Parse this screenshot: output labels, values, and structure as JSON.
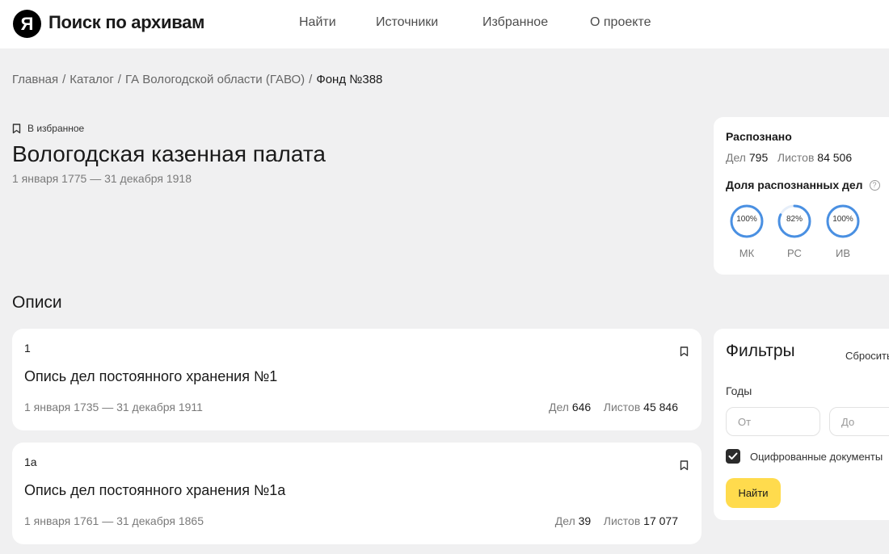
{
  "header": {
    "logo_letter": "Я",
    "logo_text": "Поиск по архивам",
    "nav": [
      "Найти",
      "Источники",
      "Избранное",
      "О проекте"
    ]
  },
  "breadcrumb": [
    "Главная",
    "Каталог",
    "ГА Вологодской области (ГАВО)",
    "Фонд №388"
  ],
  "fund": {
    "favorite_label": "В избранное",
    "title": "Вологодская казенная палата",
    "dates": "1 января 1775 — 31 декабря 1918"
  },
  "recognized": {
    "title": "Распознано",
    "cases_label": "Дел",
    "cases_value": "795",
    "sheets_label": "Листов",
    "sheets_value": "84 506",
    "share_title": "Доля распознанных дел",
    "help_icon": "?",
    "gauges": [
      {
        "label": "МК",
        "value_text": "100%",
        "percent": 100
      },
      {
        "label": "РС",
        "value_text": "82%",
        "percent": 82
      },
      {
        "label": "ИВ",
        "value_text": "100%",
        "percent": 100
      }
    ]
  },
  "inventories": {
    "section_title": "Описи",
    "items": [
      {
        "number": "1",
        "title": "Опись дел постоянного хранения №1",
        "dates": "1 января 1735 — 31 декабря 1911",
        "cases_label": "Дел",
        "cases_value": "646",
        "sheets_label": "Листов",
        "sheets_value": "45 846"
      },
      {
        "number": "1а",
        "title": "Опись дел постоянного хранения №1а",
        "dates": "1 января 1761 — 31 декабря 1865",
        "cases_label": "Дел",
        "cases_value": "39",
        "sheets_label": "Листов",
        "sheets_value": "17 077"
      }
    ]
  },
  "filters": {
    "title": "Фильтры",
    "reset_label": "Сбросить",
    "years_label": "Годы",
    "from_placeholder": "От",
    "to_placeholder": "До",
    "digitized_label": "Оцифрованные документы",
    "digitized_checked": true,
    "submit_label": "Найти"
  },
  "colors": {
    "accent": "#ffdb4d",
    "gauge": "#4a90e2",
    "background": "#f0f0f1"
  }
}
